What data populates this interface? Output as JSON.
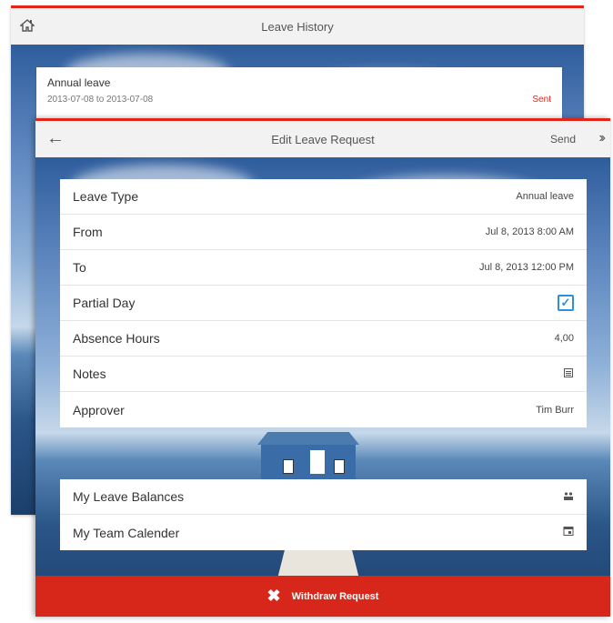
{
  "history": {
    "title": "Leave History",
    "home_icon": "home-icon",
    "entry": {
      "type": "Annual leave",
      "dates": "2013-07-08 to 2013-07-08",
      "status": "Sent",
      "status_color": "#e1251b"
    }
  },
  "edit": {
    "title": "Edit Leave Request",
    "back_icon": "back-arrow-icon",
    "send_label": "Send",
    "fields": [
      {
        "label": "Leave Type",
        "value": "Annual leave"
      },
      {
        "label": "From",
        "value": "Jul 8, 2013 8:00 AM"
      },
      {
        "label": "To",
        "value": "Jul 8, 2013 12:00 PM"
      },
      {
        "label": "Partial Day",
        "checked": true
      },
      {
        "label": "Absence Hours",
        "value": "4,00"
      },
      {
        "label": "Notes",
        "icon": "notes-icon"
      },
      {
        "label": "Approver",
        "value": "Tim Burr"
      }
    ],
    "links": [
      {
        "label": "My Leave Balances",
        "icon": "balances-icon"
      },
      {
        "label": "My Team Calender",
        "icon": "calendar-icon"
      }
    ],
    "withdraw_label": "Withdraw Request",
    "accent": "#d7271b"
  }
}
